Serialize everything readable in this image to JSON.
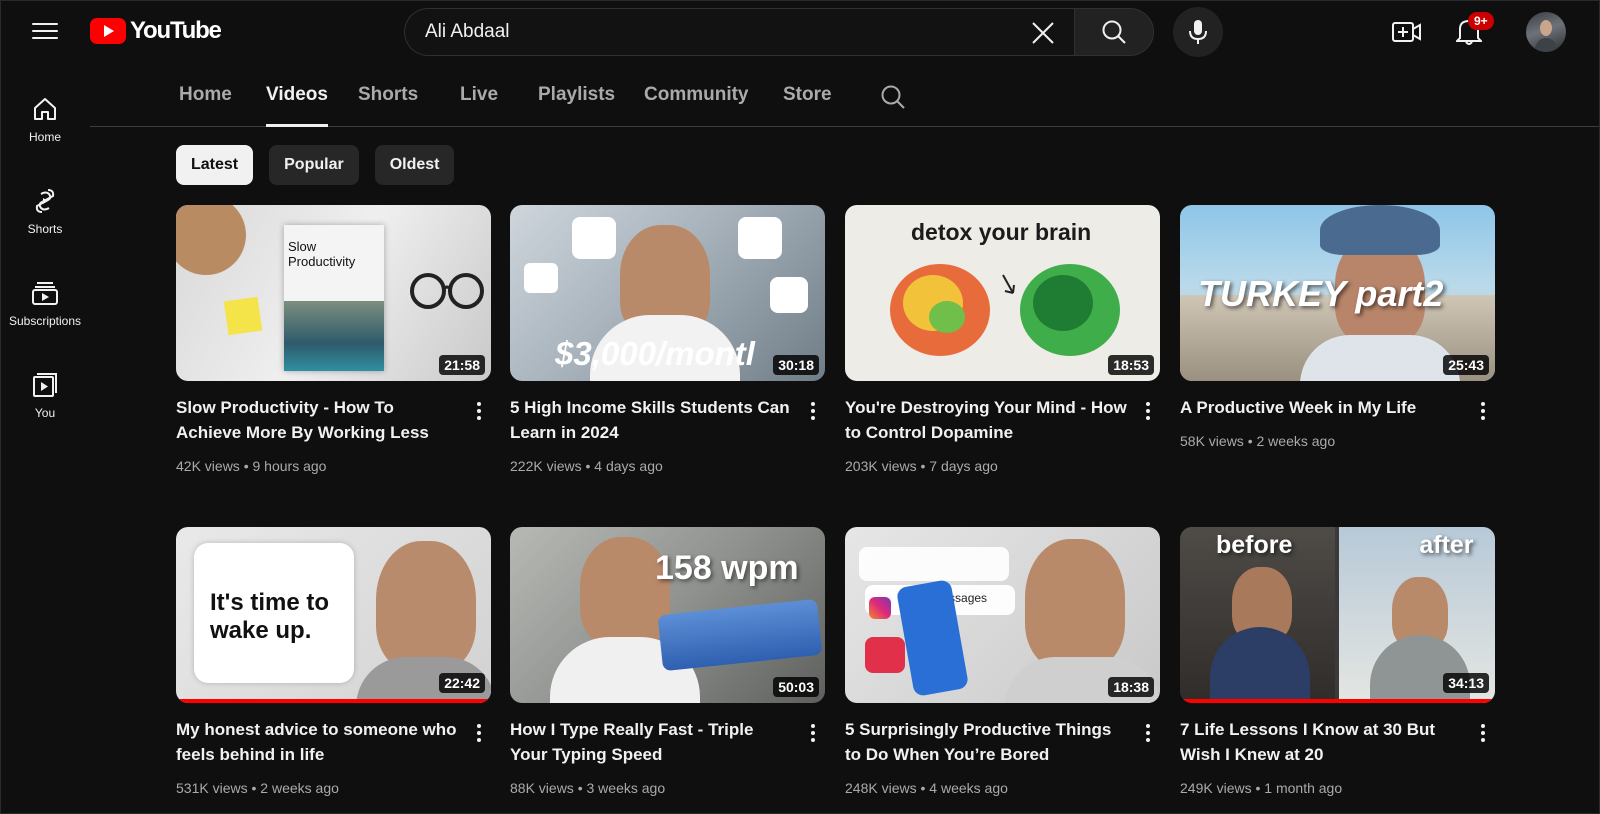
{
  "header": {
    "logo_text": "YouTube",
    "search_value": "Ali Abdaal",
    "notification_badge": "9+",
    "accent_color": "#ff0000"
  },
  "sidebar": {
    "items": [
      {
        "label": "Home",
        "icon": "home-icon"
      },
      {
        "label": "Shorts",
        "icon": "shorts-icon"
      },
      {
        "label": "Subscriptions",
        "icon": "subscriptions-icon"
      },
      {
        "label": "You",
        "icon": "you-icon"
      }
    ]
  },
  "tabs": [
    {
      "label": "Home"
    },
    {
      "label": "Videos",
      "active": true
    },
    {
      "label": "Shorts"
    },
    {
      "label": "Live"
    },
    {
      "label": "Playlists"
    },
    {
      "label": "Community"
    },
    {
      "label": "Store"
    }
  ],
  "chips": [
    {
      "label": "Latest",
      "active": true
    },
    {
      "label": "Popular"
    },
    {
      "label": "Oldest"
    }
  ],
  "videos": [
    {
      "title": "Slow Productivity - How To Achieve More By Working Less",
      "views": "42K views",
      "age": "9 hours ago",
      "duration": "21:58",
      "thumb_text": "Slow Productivity",
      "progress": 0
    },
    {
      "title": "5 High Income Skills Students Can Learn in 2024",
      "views": "222K views",
      "age": "4 days ago",
      "duration": "30:18",
      "thumb_text": "$3,000/montl",
      "progress": 0
    },
    {
      "title": "You're Destroying Your Mind - How to Control Dopamine",
      "views": "203K views",
      "age": "7 days ago",
      "duration": "18:53",
      "thumb_text": "detox your brain",
      "progress": 0
    },
    {
      "title": "A Productive Week in My Life",
      "views": "58K views",
      "age": "2 weeks ago",
      "duration": "25:43",
      "thumb_text": "TURKEY part2",
      "progress": 0
    },
    {
      "title": "My honest advice to someone who feels behind in life",
      "views": "531K views",
      "age": "2 weeks ago",
      "duration": "22:42",
      "thumb_text": "It's time to wake up.",
      "progress": 1
    },
    {
      "title": "How I Type Really Fast - Triple Your Typing Speed",
      "views": "88K views",
      "age": "3 weeks ago",
      "duration": "50:03",
      "thumb_text": "158 wpm",
      "progress": 0
    },
    {
      "title": "5 Surprisingly Productive Things to Do When You’re Bored",
      "views": "248K views",
      "age": "4 weeks ago",
      "duration": "18:38",
      "thumb_text": "7 new messages",
      "progress": 0
    },
    {
      "title": "7 Life Lessons I Know at 30 But Wish I Knew at 20",
      "views": "249K views",
      "age": "1 month ago",
      "duration": "34:13",
      "thumb_text": "before after",
      "progress": 1
    }
  ]
}
